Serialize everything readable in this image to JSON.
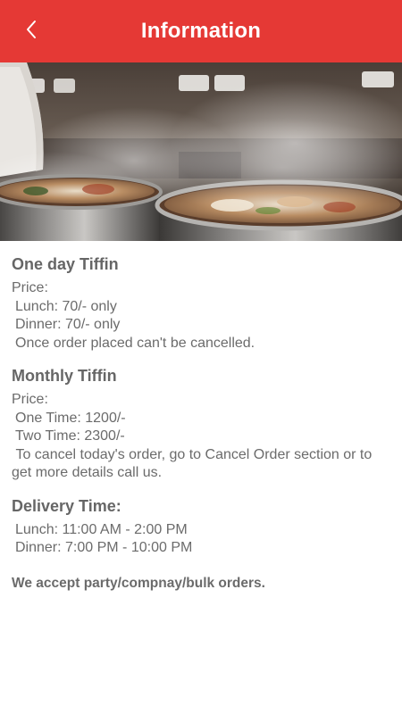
{
  "header": {
    "title": "Information"
  },
  "colors": {
    "header_bg": "#e53935",
    "header_text": "#ffffff",
    "body_text": "#6b6b6b"
  },
  "icons": {
    "back": "chevron-left-icon"
  },
  "hero": {
    "image": "kitchen-cooking-pots-photo"
  },
  "one_day": {
    "title": "One day Tiffin",
    "price_label": "Price:",
    "lunch": "Lunch: 70/- only",
    "dinner": "Dinner: 70/- only",
    "note": "Once order placed can't be cancelled."
  },
  "monthly": {
    "title": "Monthly Tiffin",
    "price_label": "Price:",
    "one_time": "One Time: 1200/-",
    "two_time": "Two Time: 2300/-",
    "note": "To cancel today's order, go to Cancel Order section or to get more details call us."
  },
  "delivery": {
    "title": "Delivery Time:",
    "lunch": "Lunch: 11:00 AM - 2:00 PM",
    "dinner": "Dinner: 7:00 PM - 10:00 PM"
  },
  "footer": {
    "note": "We accept party/compnay/bulk orders."
  }
}
